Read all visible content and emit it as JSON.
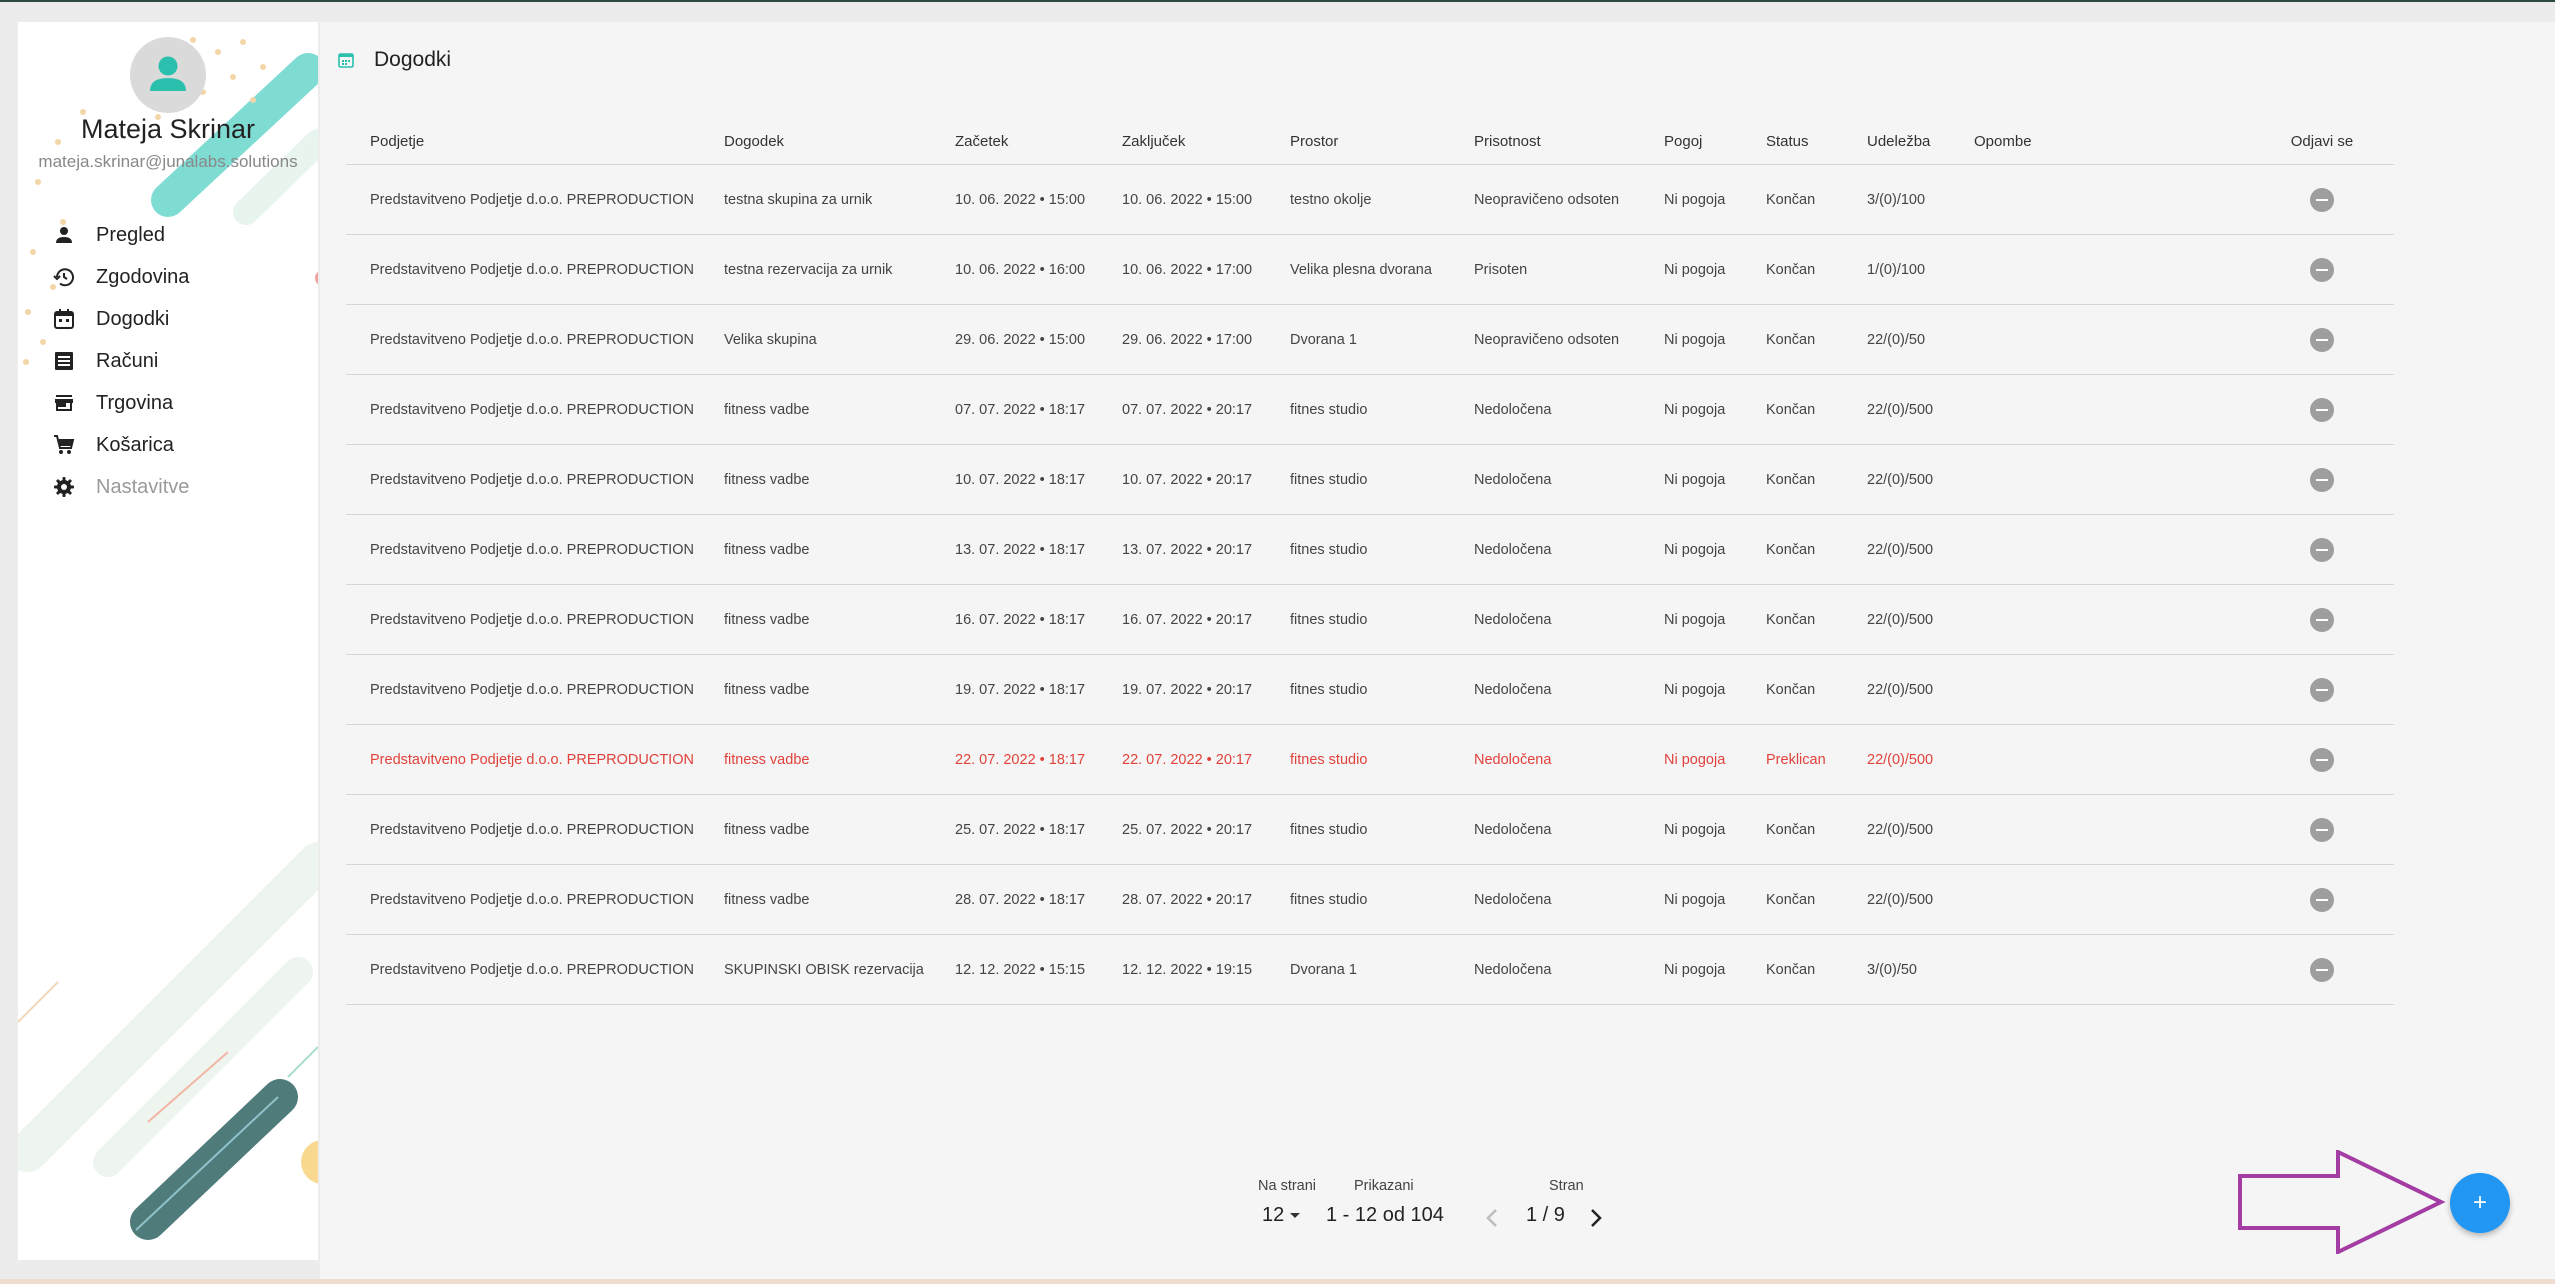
{
  "user": {
    "name": "Mateja Skrinar",
    "email": "mateja.skrinar@junalabs.solutions"
  },
  "sidebar": {
    "items": [
      {
        "label": "Pregled",
        "icon": "person-icon"
      },
      {
        "label": "Zgodovina",
        "icon": "history-icon"
      },
      {
        "label": "Dogodki",
        "icon": "calendar-icon"
      },
      {
        "label": "Računi",
        "icon": "receipt-icon"
      },
      {
        "label": "Trgovina",
        "icon": "store-icon"
      },
      {
        "label": "Košarica",
        "icon": "cart-icon"
      },
      {
        "label": "Nastavitve",
        "icon": "gear-icon",
        "disabled": true
      }
    ]
  },
  "page": {
    "title": "Dogodki",
    "title_icon": "calendar-icon"
  },
  "table": {
    "headers": [
      "Podjetje",
      "Dogodek",
      "Začetek",
      "Zaključek",
      "Prostor",
      "Prisotnost",
      "Pogoj",
      "Status",
      "Udeležba",
      "Opombe",
      "Odjavi se"
    ],
    "rows": [
      {
        "company": "Predstavitveno Podjetje d.o.o. PREPRODUCTION",
        "event": "testna skupina za urnik",
        "start": "10. 06. 2022 • 15:00",
        "end": "10. 06. 2022 • 15:00",
        "venue": "testno okolje",
        "attendance": "Neopravičeno odsoten",
        "condition": "Ni pogoja",
        "status": "Končan",
        "participation": "3/(0)/100",
        "notes": ""
      },
      {
        "company": "Predstavitveno Podjetje d.o.o. PREPRODUCTION",
        "event": "testna rezervacija za urnik",
        "start": "10. 06. 2022 • 16:00",
        "end": "10. 06. 2022 • 17:00",
        "venue": "Velika plesna dvorana",
        "attendance": "Prisoten",
        "condition": "Ni pogoja",
        "status": "Končan",
        "participation": "1/(0)/100",
        "notes": ""
      },
      {
        "company": "Predstavitveno Podjetje d.o.o. PREPRODUCTION",
        "event": "Velika skupina",
        "start": "29. 06. 2022 • 15:00",
        "end": "29. 06. 2022 • 17:00",
        "venue": "Dvorana 1",
        "attendance": "Neopravičeno odsoten",
        "condition": "Ni pogoja",
        "status": "Končan",
        "participation": "22/(0)/50",
        "notes": ""
      },
      {
        "company": "Predstavitveno Podjetje d.o.o. PREPRODUCTION",
        "event": "fitness vadbe",
        "start": "07. 07. 2022 • 18:17",
        "end": "07. 07. 2022 • 20:17",
        "venue": "fitnes studio",
        "attendance": "Nedoločena",
        "condition": "Ni pogoja",
        "status": "Končan",
        "participation": "22/(0)/500",
        "notes": ""
      },
      {
        "company": "Predstavitveno Podjetje d.o.o. PREPRODUCTION",
        "event": "fitness vadbe",
        "start": "10. 07. 2022 • 18:17",
        "end": "10. 07. 2022 • 20:17",
        "venue": "fitnes studio",
        "attendance": "Nedoločena",
        "condition": "Ni pogoja",
        "status": "Končan",
        "participation": "22/(0)/500",
        "notes": ""
      },
      {
        "company": "Predstavitveno Podjetje d.o.o. PREPRODUCTION",
        "event": "fitness vadbe",
        "start": "13. 07. 2022 • 18:17",
        "end": "13. 07. 2022 • 20:17",
        "venue": "fitnes studio",
        "attendance": "Nedoločena",
        "condition": "Ni pogoja",
        "status": "Končan",
        "participation": "22/(0)/500",
        "notes": ""
      },
      {
        "company": "Predstavitveno Podjetje d.o.o. PREPRODUCTION",
        "event": "fitness vadbe",
        "start": "16. 07. 2022 • 18:17",
        "end": "16. 07. 2022 • 20:17",
        "venue": "fitnes studio",
        "attendance": "Nedoločena",
        "condition": "Ni pogoja",
        "status": "Končan",
        "participation": "22/(0)/500",
        "notes": ""
      },
      {
        "company": "Predstavitveno Podjetje d.o.o. PREPRODUCTION",
        "event": "fitness vadbe",
        "start": "19. 07. 2022 • 18:17",
        "end": "19. 07. 2022 • 20:17",
        "venue": "fitnes studio",
        "attendance": "Nedoločena",
        "condition": "Ni pogoja",
        "status": "Končan",
        "participation": "22/(0)/500",
        "notes": ""
      },
      {
        "company": "Predstavitveno Podjetje d.o.o. PREPRODUCTION",
        "event": "fitness vadbe",
        "start": "22. 07. 2022 • 18:17",
        "end": "22. 07. 2022 • 20:17",
        "venue": "fitnes studio",
        "attendance": "Nedoločena",
        "condition": "Ni pogoja",
        "status": "Preklican",
        "participation": "22/(0)/500",
        "notes": "",
        "cancelled": true
      },
      {
        "company": "Predstavitveno Podjetje d.o.o. PREPRODUCTION",
        "event": "fitness vadbe",
        "start": "25. 07. 2022 • 18:17",
        "end": "25. 07. 2022 • 20:17",
        "venue": "fitnes studio",
        "attendance": "Nedoločena",
        "condition": "Ni pogoja",
        "status": "Končan",
        "participation": "22/(0)/500",
        "notes": ""
      },
      {
        "company": "Predstavitveno Podjetje d.o.o. PREPRODUCTION",
        "event": "fitness vadbe",
        "start": "28. 07. 2022 • 18:17",
        "end": "28. 07. 2022 • 20:17",
        "venue": "fitnes studio",
        "attendance": "Nedoločena",
        "condition": "Ni pogoja",
        "status": "Končan",
        "participation": "22/(0)/500",
        "notes": ""
      },
      {
        "company": "Predstavitveno Podjetje d.o.o. PREPRODUCTION",
        "event": "SKUPINSKI OBISK  rezervacija",
        "start": "12. 12. 2022 • 15:15",
        "end": "12. 12. 2022 • 19:15",
        "venue": "Dvorana 1",
        "attendance": "Nedoločena",
        "condition": "Ni pogoja",
        "status": "Končan",
        "participation": "3/(0)/50",
        "notes": ""
      }
    ]
  },
  "pagination": {
    "per_page_label": "Na strani",
    "per_page_value": "12",
    "shown_label": "Prikazani",
    "shown_value": "1 - 12 od 104",
    "page_label": "Stran",
    "page_value": "1 / 9"
  },
  "fab": {
    "label": "+",
    "icon": "plus-icon"
  },
  "colors": {
    "accent": "#2196f3",
    "cancelled": "#e0423b",
    "avatar_icon": "#2bbfae",
    "annotation_arrow": "#a33da3"
  }
}
